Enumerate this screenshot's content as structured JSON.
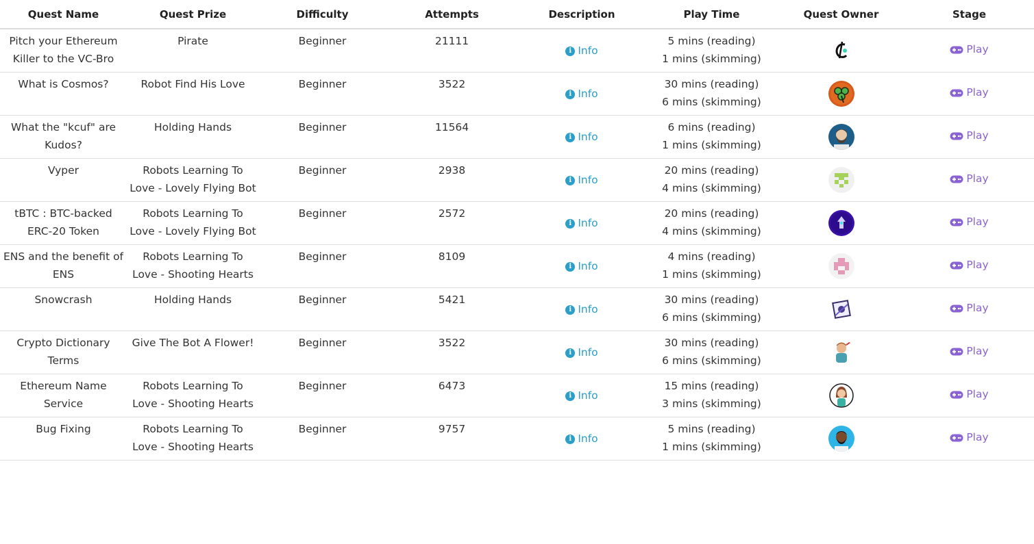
{
  "headers": {
    "name": "Quest Name",
    "prize": "Quest Prize",
    "difficulty": "Difficulty",
    "attempts": "Attempts",
    "description": "Description",
    "playtime": "Play Time",
    "owner": "Quest Owner",
    "stage": "Stage"
  },
  "info_label": "Info",
  "play_label": "Play",
  "icons": {
    "info": "info-circle-icon",
    "play": "gamepad-icon"
  },
  "colors": {
    "info": "#2a9fc9",
    "play": "#8a63d2"
  },
  "rows": [
    {
      "name": "Pitch your Ethereum Killer to the VC-Bro",
      "prize": "Pirate",
      "difficulty": "Beginner",
      "attempts": "21111",
      "reading": "5 mins (reading)",
      "skimming": "1 mins (skimming)",
      "avatar": "cosmos-logo-avatar"
    },
    {
      "name": "What is Cosmos?",
      "prize": "Robot Find His Love",
      "difficulty": "Beginner",
      "attempts": "3522",
      "reading": "30 mins (reading)",
      "skimming": "6 mins (skimming)",
      "avatar": "clover-avatar"
    },
    {
      "name": "What the \"kcuf\" are Kudos?",
      "prize": "Holding Hands",
      "difficulty": "Beginner",
      "attempts": "11564",
      "reading": "6 mins (reading)",
      "skimming": "1 mins (skimming)",
      "avatar": "bearded-man-avatar"
    },
    {
      "name": "Vyper",
      "prize": "Robots Learning To Love - Lovely Flying Bot",
      "difficulty": "Beginner",
      "attempts": "2938",
      "reading": "20 mins (reading)",
      "skimming": "4 mins (skimming)",
      "avatar": "green-identicon-avatar"
    },
    {
      "name": "tBTC : BTC-backed ERC-20 Token",
      "prize": "Robots Learning To Love - Lovely Flying Bot",
      "difficulty": "Beginner",
      "attempts": "2572",
      "reading": "20 mins (reading)",
      "skimming": "4 mins (skimming)",
      "avatar": "purple-robot-avatar"
    },
    {
      "name": "ENS and the benefit of ENS",
      "prize": "Robots Learning To Love - Shooting Hearts",
      "difficulty": "Beginner",
      "attempts": "8109",
      "reading": "4 mins (reading)",
      "skimming": "1 mins (skimming)",
      "avatar": "pink-identicon-avatar"
    },
    {
      "name": "Snowcrash",
      "prize": "Holding Hands",
      "difficulty": "Beginner",
      "attempts": "5421",
      "reading": "30 mins (reading)",
      "skimming": "6 mins (skimming)",
      "avatar": "snowcrash-avatar"
    },
    {
      "name": "Crypto Dictionary Terms",
      "prize": "Give The Bot A Flower!",
      "difficulty": "Beginner",
      "attempts": "3522",
      "reading": "30 mins (reading)",
      "skimming": "6 mins (skimming)",
      "avatar": "cartoon-man-avatar"
    },
    {
      "name": "Ethereum Name Service",
      "prize": "Robots Learning To Love - Shooting Hearts",
      "difficulty": "Beginner",
      "attempts": "6473",
      "reading": "15 mins (reading)",
      "skimming": "3 mins (skimming)",
      "avatar": "cartoon-woman-avatar"
    },
    {
      "name": "Bug Fixing",
      "prize": "Robots Learning To Love - Shooting Hearts",
      "difficulty": "Beginner",
      "attempts": "9757",
      "reading": "5 mins (reading)",
      "skimming": "1 mins (skimming)",
      "avatar": "bearded-blue-avatar"
    }
  ]
}
